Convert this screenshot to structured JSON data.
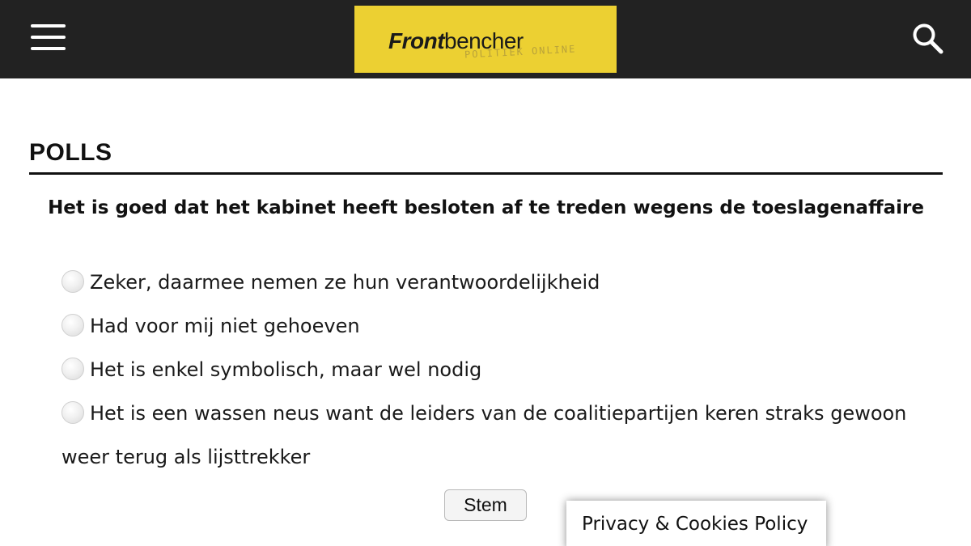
{
  "header": {
    "menu_icon": "hamburger-menu-icon",
    "logo_text_bold": "Front",
    "logo_text_regular": "bencher",
    "logo_tagline": "POLITIEK ONLINE",
    "logo_bg_color": "#ecd032",
    "search_icon": "search-icon",
    "bar_color": "#222222"
  },
  "section": {
    "title": "POLLS"
  },
  "poll": {
    "question": "Het is goed dat het kabinet heeft besloten af te treden wegens de toeslagenaffaire",
    "options": [
      {
        "label": "Zeker, daarmee nemen ze hun verantwoordelijkheid",
        "selected": false
      },
      {
        "label": "Had voor mij niet gehoeven",
        "selected": false
      },
      {
        "label": "Het is enkel symbolisch, maar wel nodig",
        "selected": false
      },
      {
        "label": "Het is een wassen neus want de leiders van de coalitiepartijen keren straks gewoon weer terug als lijsttrekker",
        "selected": false
      }
    ],
    "vote_label": "Stem"
  },
  "privacy_banner": {
    "label": "Privacy & Cookies Policy"
  }
}
